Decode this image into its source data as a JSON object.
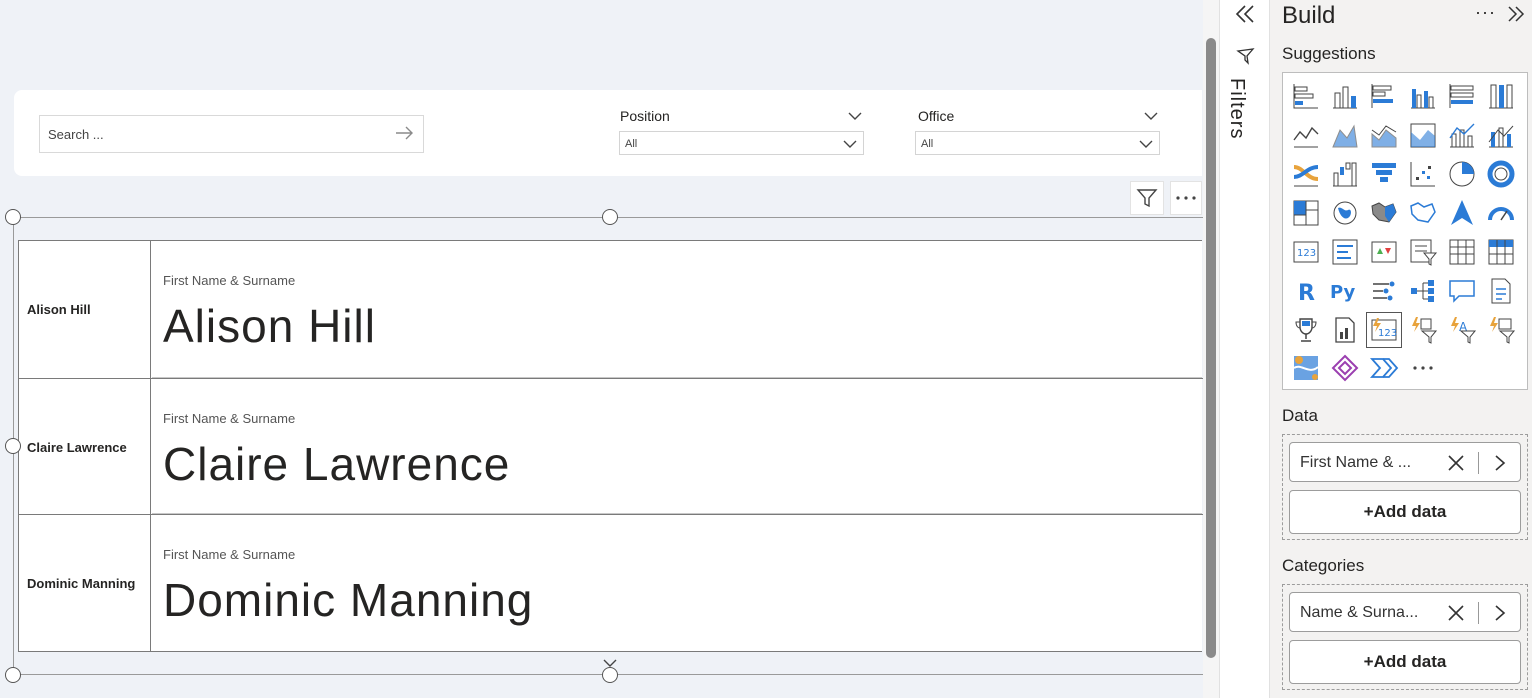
{
  "slicers": {
    "search_placeholder": "Search ...",
    "position": {
      "title": "Position",
      "value": "All"
    },
    "office": {
      "title": "Office",
      "value": "All"
    }
  },
  "table": {
    "rows": [
      {
        "category": "Alison Hill",
        "label": "First Name & Surname",
        "value": "Alison Hill"
      },
      {
        "category": "Claire Lawrence",
        "label": "First Name & Surname",
        "value": "Claire Lawrence"
      },
      {
        "category": "Dominic Manning",
        "label": "First Name & Surname",
        "value": "Dominic Manning"
      }
    ]
  },
  "filters_pane": {
    "label": "Filters"
  },
  "build_pane": {
    "title": "Build",
    "suggestions_title": "Suggestions",
    "more_glyph": "···",
    "data_title": "Data",
    "data_field": "First Name & ...",
    "categories_title": "Categories",
    "categories_field": "Name & Surna...",
    "add_data_label": "+Add data"
  },
  "colors": {
    "accent": "#118dff",
    "brand_blue": "#2b7bd6",
    "warning": "#e8a33c"
  }
}
